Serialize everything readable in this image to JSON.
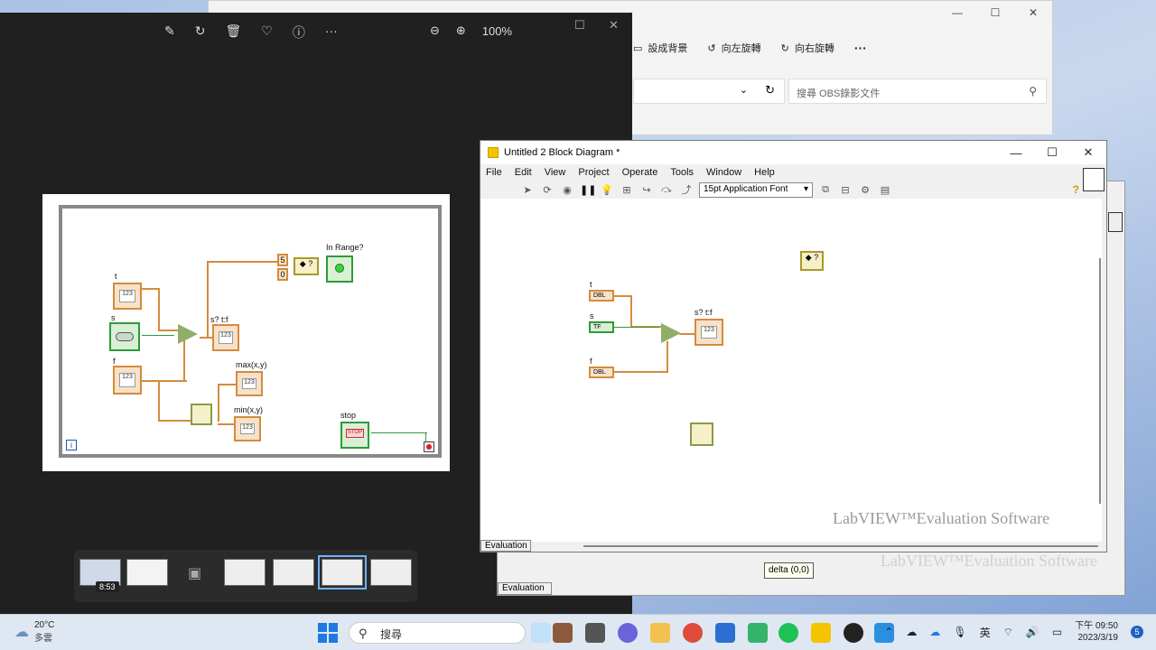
{
  "explorer": {
    "commands": [
      {
        "label": "設成背景",
        "icon": "set-background-icon"
      },
      {
        "label": "向左旋轉",
        "icon": "rotate-left-icon"
      },
      {
        "label": "向右旋轉",
        "icon": "rotate-right-icon"
      }
    ],
    "more": "···",
    "search_placeholder": "搜尋 OBS錄影文件"
  },
  "photos": {
    "zoom_level": "100%",
    "toolbar_icons": [
      "edit-icon",
      "rotate-icon",
      "delete-icon",
      "favorite-icon",
      "info-icon",
      "more-icon"
    ],
    "time_badge": "8:53",
    "diagram": {
      "labels": {
        "in_range": "In Range?",
        "t": "t",
        "s": "s",
        "f": "f",
        "s_tf": "s? t:f",
        "max": "max(x,y)",
        "min": "min(x,y)",
        "stop": "stop",
        "const_5": "5",
        "const_0": "0",
        "num": "123",
        "stop_btn": "STOP",
        "iter": "i"
      }
    }
  },
  "labview": {
    "title": "Untitled 2 Block Diagram *",
    "menu": [
      "File",
      "Edit",
      "View",
      "Project",
      "Operate",
      "Tools",
      "Window",
      "Help"
    ],
    "font": "15pt Application Font",
    "diagram": {
      "t": "t",
      "s": "s",
      "f": "f",
      "s_tf": "s? t:f",
      "dbl": "DBL",
      "tf": "TF",
      "num": "123"
    },
    "watermark": "LabVIEW™Evaluation Software",
    "status": "Evaluation"
  },
  "labview_back": {
    "watermark": "LabVIEW™Evaluation Software",
    "status": "Evaluation"
  },
  "tooltip": "delta (0,0)",
  "taskbar": {
    "weather_temp": "20°C",
    "weather_desc": "多雲",
    "search": "搜尋",
    "ime": "英",
    "time": "下午 09:50",
    "date": "2023/3/19",
    "notifications": "5"
  }
}
